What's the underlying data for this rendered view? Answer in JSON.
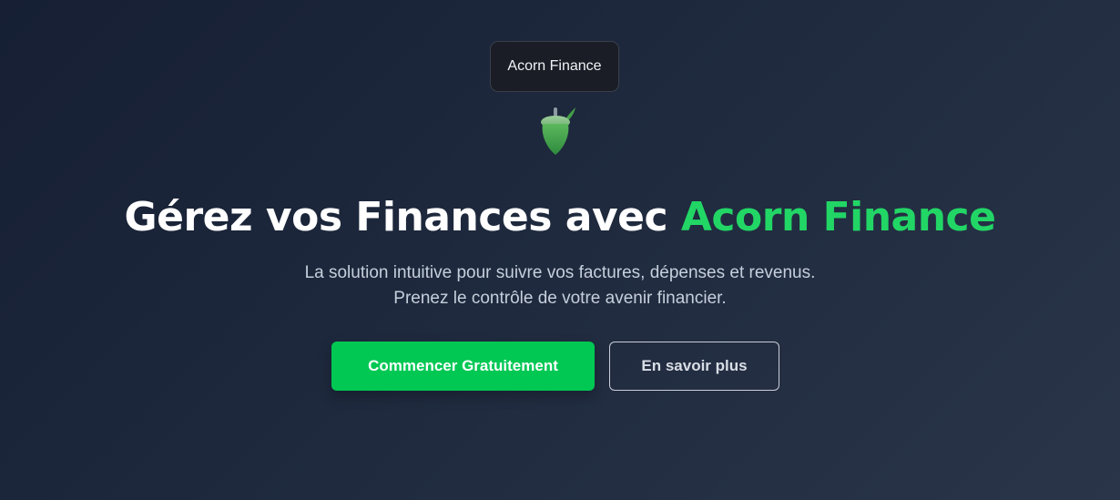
{
  "tooltip": {
    "text": "Acorn Finance"
  },
  "logo": {
    "icon": "acorn-icon",
    "color": "#4caf50"
  },
  "hero": {
    "title_main": "Gérez vos Finances avec ",
    "title_accent": "Acorn Finance",
    "subtitle_line1": "La solution intuitive pour suivre vos factures, dépenses et revenus.",
    "subtitle_line2": "Prenez le contrôle de votre avenir financier."
  },
  "buttons": {
    "primary_label": "Commencer Gratuitement",
    "secondary_label": "En savoir plus"
  },
  "colors": {
    "accent": "#22d666",
    "primary_button": "#00c853",
    "background": "#1e293d"
  }
}
